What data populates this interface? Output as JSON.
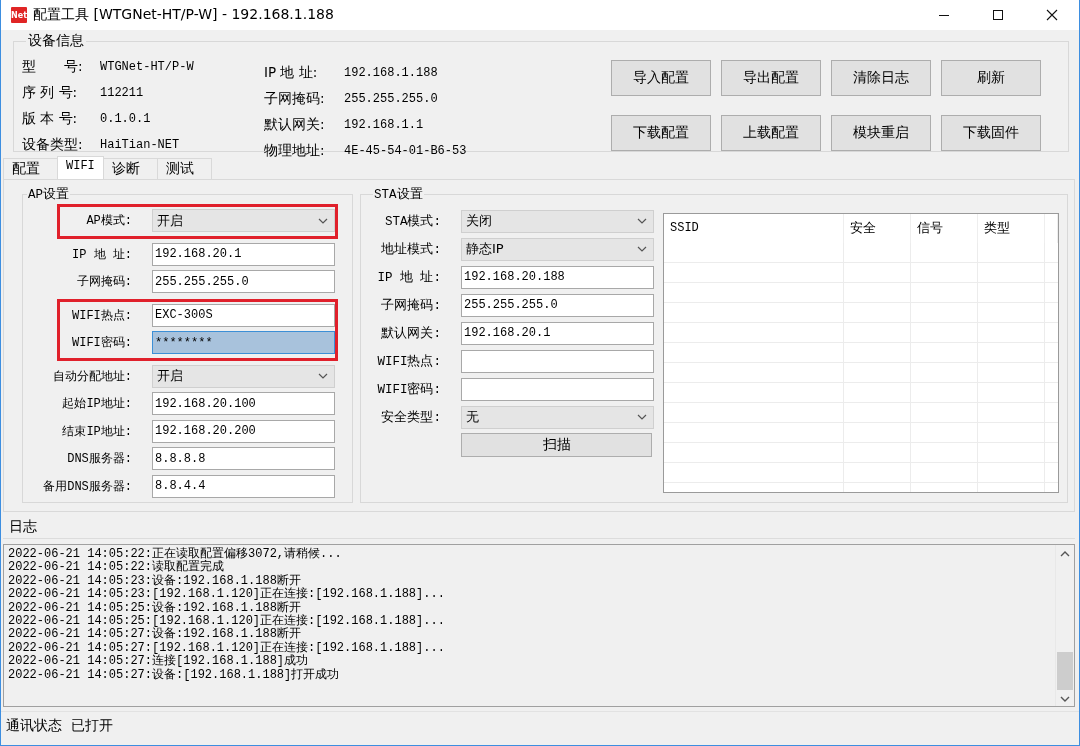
{
  "window": {
    "icon_text": "Net",
    "title": "配置工具 [WTGNet-HT/P-W] - 192.168.1.188"
  },
  "device_info": {
    "title": "设备信息",
    "left": [
      {
        "label": "型　　号:",
        "value": "WTGNet-HT/P-W"
      },
      {
        "label": "序 列 号:",
        "value": "112211"
      },
      {
        "label": "版 本 号:",
        "value": "0.1.0.1"
      },
      {
        "label": "设备类型:",
        "value": "HaiTian-NET"
      }
    ],
    "right": [
      {
        "label": "IP 地 址:",
        "value": "192.168.1.188"
      },
      {
        "label": "子网掩码:",
        "value": "255.255.255.0"
      },
      {
        "label": "默认网关:",
        "value": "192.168.1.1"
      },
      {
        "label": "物理地址:",
        "value": "4E-45-54-01-B6-53"
      }
    ],
    "buttons": [
      "导入配置",
      "导出配置",
      "清除日志",
      "刷新",
      "下载配置",
      "上载配置",
      "模块重启",
      "下载固件"
    ]
  },
  "tabs": [
    {
      "label": "配置",
      "selected": false
    },
    {
      "label": "WIFI",
      "selected": true
    },
    {
      "label": "诊断",
      "selected": false
    },
    {
      "label": "测试",
      "selected": false
    }
  ],
  "ap": {
    "title": "AP设置",
    "blocks": [
      {
        "highlight": true,
        "fields": [
          {
            "label": "AP模式:",
            "kind": "select",
            "value": "开启"
          }
        ]
      },
      {
        "highlight": false,
        "fields": [
          {
            "label": "IP 地 址:",
            "kind": "input",
            "value": "192.168.20.1",
            "selected": false
          },
          {
            "label": "子网掩码:",
            "kind": "input",
            "value": "255.255.255.0",
            "selected": false
          }
        ]
      },
      {
        "highlight": true,
        "fields": [
          {
            "label": "WIFI热点:",
            "kind": "input",
            "value": "EXC-300S",
            "selected": false
          },
          {
            "label": "WIFI密码:",
            "kind": "input",
            "value": "********",
            "selected": true
          }
        ]
      },
      {
        "highlight": false,
        "fields": [
          {
            "label": "自动分配地址:",
            "kind": "select",
            "value": "开启"
          },
          {
            "label": "起始IP地址:",
            "kind": "input",
            "value": "192.168.20.100",
            "selected": false
          },
          {
            "label": "结束IP地址:",
            "kind": "input",
            "value": "192.168.20.200",
            "selected": false
          },
          {
            "label": "DNS服务器:",
            "kind": "input",
            "value": "8.8.8.8",
            "selected": false
          },
          {
            "label": "备用DNS服务器:",
            "kind": "input",
            "value": "8.8.4.4",
            "selected": false
          }
        ]
      }
    ]
  },
  "sta": {
    "title": "STA设置",
    "fields": [
      {
        "label": "STA模式:",
        "kind": "select",
        "value": "关闭"
      },
      {
        "label": "地址模式:",
        "kind": "select",
        "value": "静态IP"
      },
      {
        "label": "IP 地 址:",
        "kind": "input",
        "value": "192.168.20.188"
      },
      {
        "label": "子网掩码:",
        "kind": "input",
        "value": "255.255.255.0"
      },
      {
        "label": "默认网关:",
        "kind": "input",
        "value": "192.168.20.1"
      },
      {
        "label": "WIFI热点:",
        "kind": "input"
      },
      {
        "label": "WIFI密码:",
        "kind": "input"
      },
      {
        "label": "安全类型:",
        "kind": "select",
        "value": "无"
      }
    ],
    "scan_button": "扫描",
    "table": {
      "columns": [
        "SSID",
        "安全",
        "信号",
        "类型"
      ]
    }
  },
  "log": {
    "title": "日志",
    "lines": [
      "2022-06-21 14:05:22:正在读取配置偏移3072,请稍候...",
      "2022-06-21 14:05:22:读取配置完成",
      "2022-06-21 14:05:23:设备:192.168.1.188断开",
      "2022-06-21 14:05:23:[192.168.1.120]正在连接:[192.168.1.188]...",
      "2022-06-21 14:05:25:设备:192.168.1.188断开",
      "2022-06-21 14:05:25:[192.168.1.120]正在连接:[192.168.1.188]...",
      "2022-06-21 14:05:27:设备:192.168.1.188断开",
      "2022-06-21 14:05:27:[192.168.1.120]正在连接:[192.168.1.188]...",
      "2022-06-21 14:05:27:连接[192.168.1.188]成功",
      "2022-06-21 14:05:27:设备:[192.168.1.188]打开成功"
    ]
  },
  "status_bar": {
    "label": "通讯状态",
    "value": "已打开"
  }
}
